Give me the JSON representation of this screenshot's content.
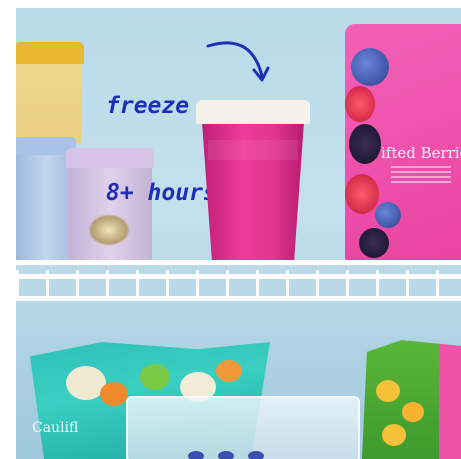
{
  "caption": {
    "line1": "freeze",
    "line2": "8+ hours"
  },
  "bag_label": "ifted Berrie",
  "bottom_bag_label": "Caulifl"
}
